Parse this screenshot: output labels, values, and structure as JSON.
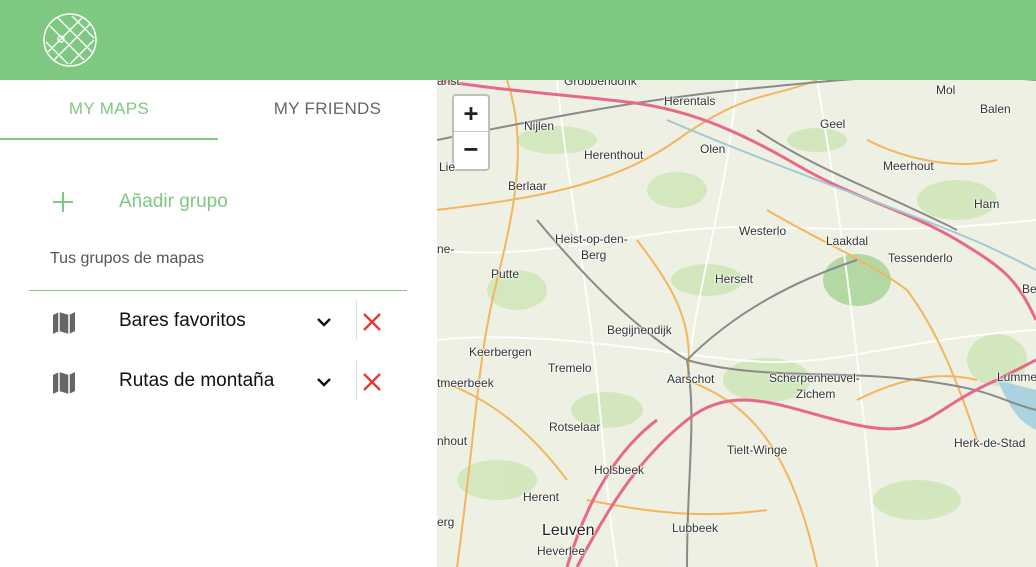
{
  "header": {
    "logo_icon": "map-grid-logo-icon",
    "bg_color": "#7ec882"
  },
  "tabs": [
    {
      "label": "MY MAPS",
      "active": true
    },
    {
      "label": "MY FRIENDS",
      "active": false
    }
  ],
  "sidebar": {
    "add_group_label": "Añadir grupo",
    "section_title": "Tus grupos de mapas",
    "groups": [
      {
        "name": "Bares favoritos",
        "icon": "map-icon"
      },
      {
        "name": "Rutas de montaña",
        "icon": "map-icon"
      }
    ]
  },
  "map": {
    "zoom_in": "+",
    "zoom_out": "−",
    "places": [
      "Grobbendonk",
      "Herentals",
      "Mol",
      "Balen",
      "Nijlen",
      "Geel",
      "Olen",
      "Herenthout",
      "Meerhout",
      "Berlaar",
      "Ham",
      "Heist-op-den-",
      "Berg",
      "Westerlo",
      "Laakdal",
      "Tessenderlo",
      "Putte",
      "Herselt",
      "Begijnendijk",
      "Keerbergen",
      "Tremelo",
      "Aarschot",
      "Scherpenheuvel-",
      "Zichem",
      "Lummen",
      "Rotselaar",
      "Tielt-Winge",
      "Herk-de-Stad",
      "Holsbeek",
      "Herent",
      "Leuven",
      "Lubbeek",
      "Heverlee",
      "anst",
      "Lie",
      "ne-",
      "tmeerbeek",
      "nhout",
      "erg",
      "Be"
    ]
  },
  "colors": {
    "accent": "#7ec882",
    "delete": "#e53935"
  }
}
